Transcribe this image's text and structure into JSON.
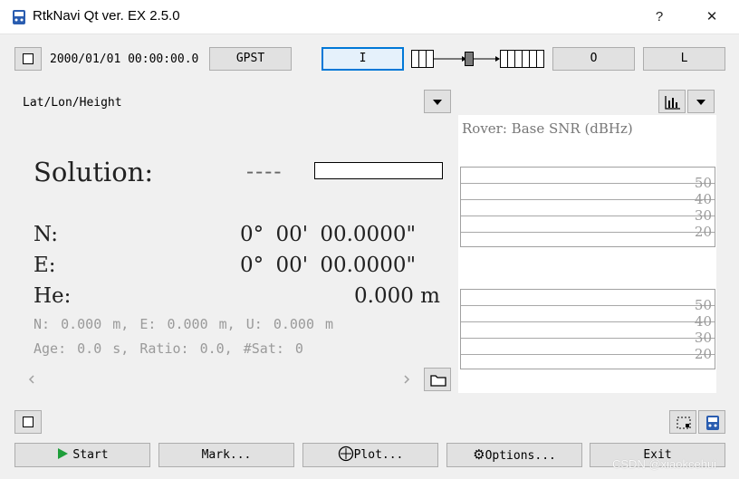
{
  "window": {
    "title": "RtkNavi Qt ver. EX 2.5.0",
    "help_label": "?",
    "close_label": "✕"
  },
  "toolbar": {
    "datetime": "2000/01/01 00:00:00.0",
    "time_system": "GPST",
    "input_label": "I",
    "output_label": "O",
    "log_label": "L"
  },
  "solution_panel": {
    "format": "Lat/Lon/Height",
    "solution_label": "Solution:",
    "solution_status": "----",
    "n_label": "N:",
    "n_value": "0° 00' 00.0000\"",
    "e_label": "E:",
    "e_value": "0° 00' 00.0000\"",
    "he_label": "He:",
    "he_value": "0.000 m",
    "neu_line": "N: 0.000 m, E: 0.000 m, U: 0.000 m",
    "age_line": "Age: 0.0 s, Ratio: 0.0, #Sat: 0"
  },
  "snr_panel": {
    "title": "Rover: Base SNR (dBHz)",
    "levels": [
      "50",
      "40",
      "30",
      "20"
    ]
  },
  "buttons": {
    "start": "Start",
    "mark": "Mark...",
    "plot": "Plot...",
    "options": "Options...",
    "exit": "Exit"
  },
  "watermark": "CSDN @xiaokcehui",
  "colors": {
    "accent": "#0078d7",
    "start_icon": "#1e9e3a"
  }
}
